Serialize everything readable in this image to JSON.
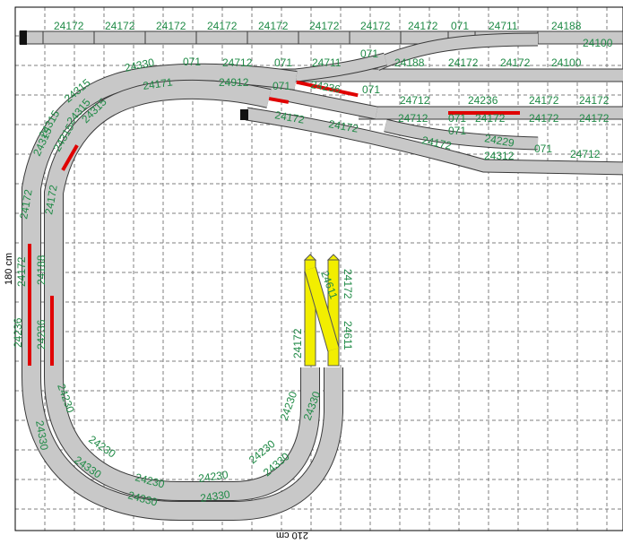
{
  "axes": {
    "bottom_label": "210 cm",
    "left_label": "180 cm"
  },
  "colors": {
    "track": "#c8c8c8",
    "track_edge": "#3a3a3a",
    "label": "#1f8a46",
    "isolated": "#e00000",
    "selected": "#f2ee00",
    "grid": "#7f7f7f"
  },
  "labels": {
    "top_row": [
      "24172",
      "24172",
      "24172",
      "24172",
      "24172",
      "24172",
      "24172",
      "24172",
      "071",
      "24711",
      "24188"
    ],
    "row2": [
      "24330",
      "071",
      "24712",
      "071",
      "24711",
      "071",
      "24188",
      "24172",
      "24172",
      "24100",
      "24100"
    ],
    "row3": [
      "24171",
      "24912",
      "071",
      "24236",
      "071",
      "24712",
      "24236",
      "24172",
      "24172",
      "24172",
      "24712",
      "071",
      "24172",
      "24172"
    ],
    "row4": [
      "24172",
      "24172",
      "24229",
      "071",
      "24712",
      "24172",
      "071",
      "24312"
    ],
    "left_curve": [
      "24315",
      "24315",
      "24315",
      "24315",
      "24315",
      "24315",
      "24172",
      "24172",
      "24172",
      "24188",
      "24236",
      "24236"
    ],
    "bottom_loop": [
      "24330",
      "24230",
      "24230",
      "24330",
      "24230",
      "24330",
      "24230",
      "24330",
      "24230",
      "24330",
      "24230",
      "24330"
    ],
    "yellow": [
      "24172",
      "24172",
      "24611",
      "24611"
    ]
  }
}
